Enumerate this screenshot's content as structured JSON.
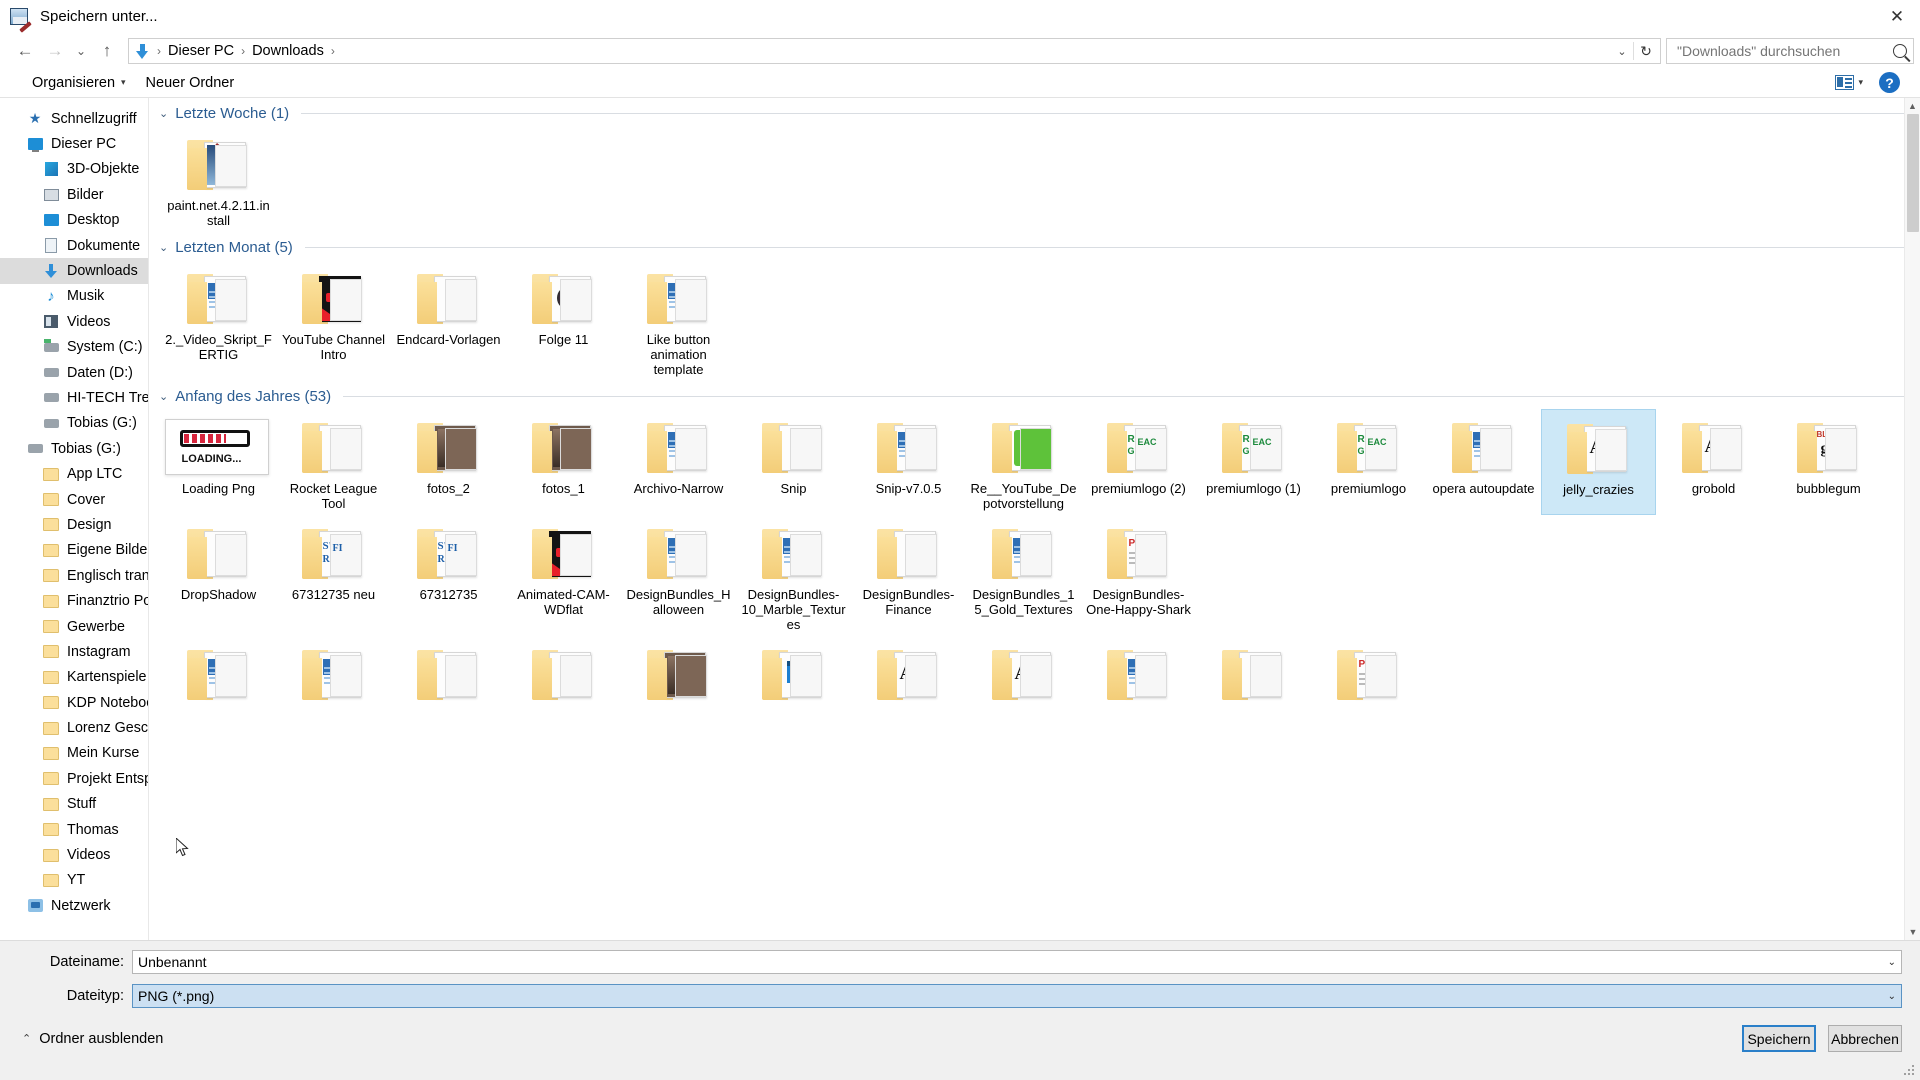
{
  "window": {
    "title": "Speichern unter...",
    "icon": "paintnet-icon",
    "close_label": "✕"
  },
  "nav": {
    "back_label": "←",
    "forward_label": "→",
    "recent_label": "⌄",
    "up_label": "↑",
    "breadcrumb": [
      "Dieser PC",
      "Downloads"
    ],
    "breadcrumb_sep": "›",
    "address_dropdown": "⌄",
    "refresh_label": "↻"
  },
  "search": {
    "placeholder": "\"Downloads\" durchsuchen",
    "value": "",
    "icon": "search-icon"
  },
  "toolbar": {
    "organize_label": "Organisieren",
    "organize_caret": "▾",
    "new_folder_label": "Neuer Ordner",
    "view_caret": "▾",
    "help_label": "?"
  },
  "sidebar": {
    "items": [
      {
        "label": "Schnellzugriff",
        "icon": "star-icon",
        "level": 1,
        "selected": false
      },
      {
        "label": "Dieser PC",
        "icon": "pc-icon",
        "level": 1,
        "selected": false
      },
      {
        "label": "3D-Objekte",
        "icon": "3d-objects-icon",
        "level": 2,
        "selected": false
      },
      {
        "label": "Bilder",
        "icon": "pictures-icon",
        "level": 2,
        "selected": false
      },
      {
        "label": "Desktop",
        "icon": "desktop-icon",
        "level": 2,
        "selected": false
      },
      {
        "label": "Dokumente",
        "icon": "documents-icon",
        "level": 2,
        "selected": false
      },
      {
        "label": "Downloads",
        "icon": "downloads-icon",
        "level": 2,
        "selected": true
      },
      {
        "label": "Musik",
        "icon": "music-icon",
        "level": 2,
        "selected": false
      },
      {
        "label": "Videos",
        "icon": "videos-icon",
        "level": 2,
        "selected": false
      },
      {
        "label": "System (C:)",
        "icon": "system-drive-icon",
        "level": 2,
        "selected": false
      },
      {
        "label": "Daten (D:)",
        "icon": "drive-icon",
        "level": 2,
        "selected": false
      },
      {
        "label": "HI-TECH Treiber (E:)",
        "icon": "drive-icon",
        "level": 2,
        "selected": false
      },
      {
        "label": "Tobias (G:)",
        "icon": "drive-icon",
        "level": 2,
        "selected": false
      },
      {
        "label": "Tobias (G:)",
        "icon": "drive-icon",
        "level": 1,
        "selected": false
      },
      {
        "label": "App LTC",
        "icon": "folder-icon",
        "level": 2,
        "selected": false
      },
      {
        "label": "Cover",
        "icon": "folder-icon",
        "level": 2,
        "selected": false
      },
      {
        "label": "Design",
        "icon": "folder-icon",
        "level": 2,
        "selected": false
      },
      {
        "label": "Eigene Bilder",
        "icon": "folder-icon",
        "level": 2,
        "selected": false
      },
      {
        "label": "Englisch translate",
        "icon": "folder-icon",
        "level": 2,
        "selected": false
      },
      {
        "label": "Finanztrio Podcast",
        "icon": "folder-icon",
        "level": 2,
        "selected": false
      },
      {
        "label": "Gewerbe",
        "icon": "folder-icon",
        "level": 2,
        "selected": false
      },
      {
        "label": "Instagram",
        "icon": "folder-icon",
        "level": 2,
        "selected": false
      },
      {
        "label": "Kartenspiele",
        "icon": "folder-icon",
        "level": 2,
        "selected": false
      },
      {
        "label": "KDP Notebook",
        "icon": "folder-icon",
        "level": 2,
        "selected": false
      },
      {
        "label": "Lorenz Geschenk",
        "icon": "folder-icon",
        "level": 2,
        "selected": false
      },
      {
        "label": "Mein Kurse",
        "icon": "folder-icon",
        "level": 2,
        "selected": false
      },
      {
        "label": "Projekt Entspannun",
        "icon": "folder-icon",
        "level": 2,
        "selected": false
      },
      {
        "label": "Stuff",
        "icon": "folder-icon",
        "level": 2,
        "selected": false
      },
      {
        "label": "Thomas",
        "icon": "folder-icon",
        "level": 2,
        "selected": false
      },
      {
        "label": "Videos",
        "icon": "folder-icon",
        "level": 2,
        "selected": false
      },
      {
        "label": "YT",
        "icon": "folder-icon",
        "level": 2,
        "selected": false
      },
      {
        "label": "Netzwerk",
        "icon": "network-icon",
        "level": 1,
        "selected": false
      }
    ]
  },
  "file_list": {
    "groups": [
      {
        "title": "Letzte Woche (1)",
        "chevron": "⌄",
        "items": [
          {
            "label": "paint.net.4.2.11.install",
            "kind": "folder-image",
            "selected": false
          }
        ]
      },
      {
        "title": "Letzten Monat (5)",
        "chevron": "⌄",
        "items": [
          {
            "label": "2._Video_Skript_FERTIG",
            "kind": "folder-doc",
            "selected": false
          },
          {
            "label": "YouTube Channel Intro",
            "kind": "folder-dark",
            "selected": false
          },
          {
            "label": "Endcard-Vorlagen",
            "kind": "folder-blank",
            "selected": false
          },
          {
            "label": "Folge 11",
            "kind": "folder-disc",
            "selected": false
          },
          {
            "label": "Like button animation template",
            "kind": "folder-doc",
            "selected": false
          }
        ]
      },
      {
        "title": "Anfang des Jahres (53)",
        "chevron": "⌄",
        "items": [
          {
            "label": "Loading Png",
            "kind": "image-loading",
            "selected": false
          },
          {
            "label": "Rocket League Tool",
            "kind": "folder-blank",
            "selected": false
          },
          {
            "label": "fotos_2",
            "kind": "folder-photo",
            "selected": false
          },
          {
            "label": "fotos_1",
            "kind": "folder-photo",
            "selected": false
          },
          {
            "label": "Archivo-Narrow",
            "kind": "folder-doc",
            "selected": false
          },
          {
            "label": "Snip",
            "kind": "folder-blank",
            "selected": false
          },
          {
            "label": "Snip-v7.0.5",
            "kind": "folder-doc",
            "selected": false
          },
          {
            "label": "Re__YouTube_Depotvorstellung",
            "kind": "folder-green",
            "selected": false
          },
          {
            "label": "premiumlogo (2)",
            "kind": "folder-text",
            "selected": false
          },
          {
            "label": "premiumlogo (1)",
            "kind": "folder-text",
            "selected": false
          },
          {
            "label": "premiumlogo",
            "kind": "folder-text",
            "selected": false
          },
          {
            "label": "opera autoupdate",
            "kind": "folder-doc",
            "selected": false
          },
          {
            "label": "jelly_crazies",
            "kind": "folder-font",
            "selected": true
          },
          {
            "label": "grobold",
            "kind": "folder-font",
            "selected": false
          },
          {
            "label": "bubblegum",
            "kind": "folder-font2",
            "selected": false
          },
          {
            "label": "DropShadow",
            "kind": "folder-blank",
            "selected": false
          },
          {
            "label": "67312735 neu",
            "kind": "folder-font3",
            "selected": false
          },
          {
            "label": "67312735",
            "kind": "folder-font3",
            "selected": false
          },
          {
            "label": "Animated-CAM-WDflat",
            "kind": "folder-dark",
            "selected": false
          },
          {
            "label": "DesignBundles_Halloween",
            "kind": "folder-doc",
            "selected": false
          },
          {
            "label": "DesignBundles-10_Marble_Textures",
            "kind": "folder-doc",
            "selected": false
          },
          {
            "label": "DesignBundles-Finance",
            "kind": "folder-blank",
            "selected": false
          },
          {
            "label": "DesignBundles_15_Gold_Textures",
            "kind": "folder-doc",
            "selected": false
          },
          {
            "label": "DesignBundles-One-Happy-Shark",
            "kind": "folder-pdf",
            "selected": false
          }
        ]
      },
      {
        "title": "",
        "chevron": "",
        "items": [
          {
            "label": "",
            "kind": "folder-doc",
            "selected": false
          },
          {
            "label": "",
            "kind": "folder-doc",
            "selected": false
          },
          {
            "label": "",
            "kind": "folder-blank",
            "selected": false
          },
          {
            "label": "",
            "kind": "folder-blank",
            "selected": false
          },
          {
            "label": "",
            "kind": "folder-photo",
            "selected": false
          },
          {
            "label": "",
            "kind": "folder-media",
            "selected": false
          },
          {
            "label": "",
            "kind": "folder-font",
            "selected": false
          },
          {
            "label": "",
            "kind": "folder-font",
            "selected": false
          },
          {
            "label": "",
            "kind": "folder-doc",
            "selected": false
          },
          {
            "label": "",
            "kind": "folder-blank",
            "selected": false
          },
          {
            "label": "",
            "kind": "folder-pdf",
            "selected": false
          }
        ]
      }
    ]
  },
  "scrollbar": {
    "up_arrow": "▲",
    "down_arrow": "▼"
  },
  "footer": {
    "filename_label": "Dateiname:",
    "filename_value": "Unbenannt",
    "filetype_label": "Dateityp:",
    "filetype_value": "PNG (*.png)",
    "filetype_caret": "⌄",
    "filename_caret": "⌄",
    "hide_folders_label": "Ordner ausblenden",
    "hide_folders_chevron": "⌃",
    "save_label": "Speichern",
    "cancel_label": "Abbrechen"
  },
  "colors": {
    "accent": "#2a7fc9",
    "group_header": "#2b5c91",
    "selection": "#cde8f7",
    "sidebar_selection": "#dcdcdc"
  }
}
